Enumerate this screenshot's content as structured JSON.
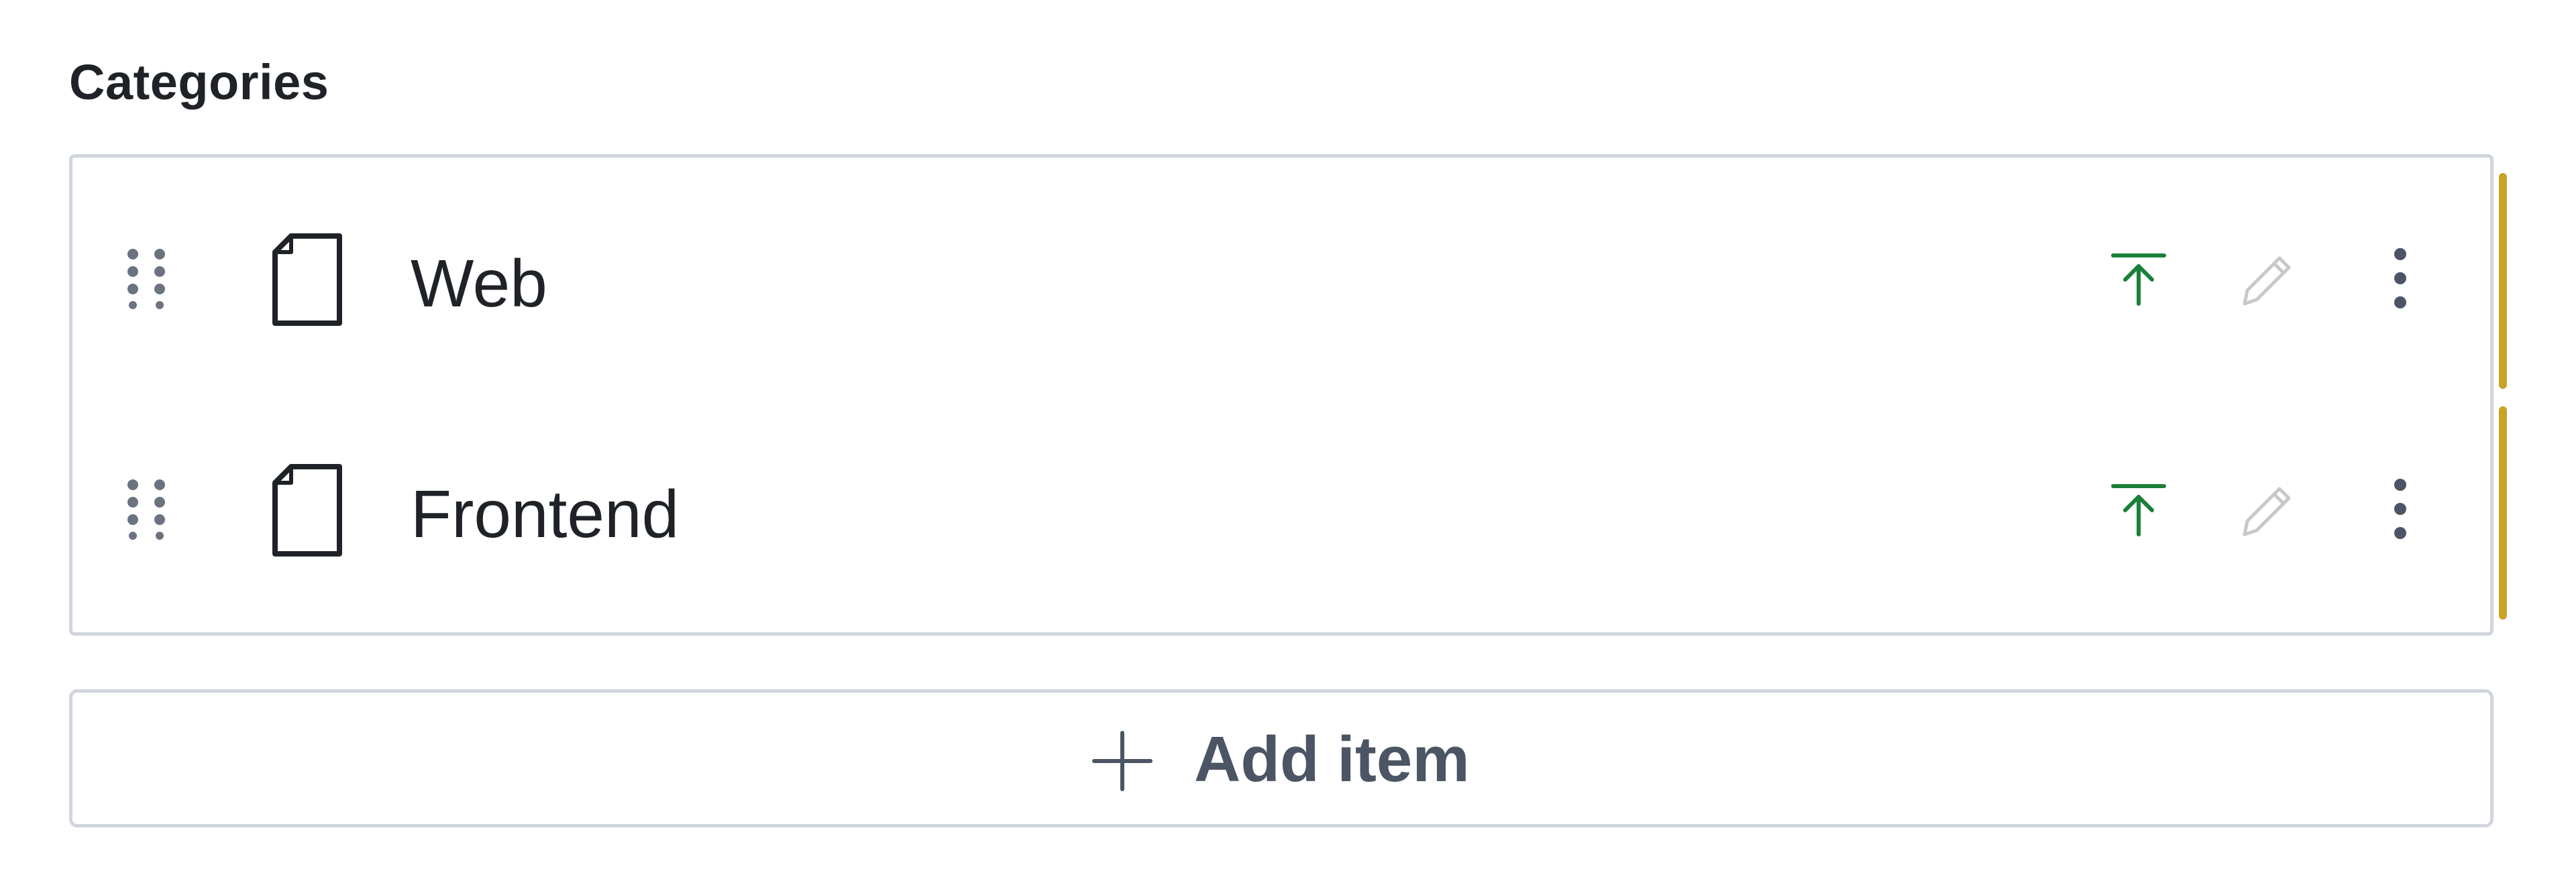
{
  "field": {
    "label": "Categories"
  },
  "items": [
    {
      "label": "Web",
      "icon": "document-icon",
      "actions": [
        "publish-icon",
        "pencil-icon",
        "kebab-menu-icon"
      ],
      "status_color": "#c9a227"
    },
    {
      "label": "Frontend",
      "icon": "document-icon",
      "actions": [
        "publish-icon",
        "pencil-icon",
        "kebab-menu-icon"
      ],
      "status_color": "#c9a227"
    }
  ],
  "add_button": {
    "label": "Add item",
    "icon": "plus-icon"
  },
  "colors": {
    "publish": "#1a7f37",
    "edit_disabled": "#c8c8c8",
    "border": "#d0d5dd",
    "text": "#1f2328",
    "status": "#c9a227"
  }
}
